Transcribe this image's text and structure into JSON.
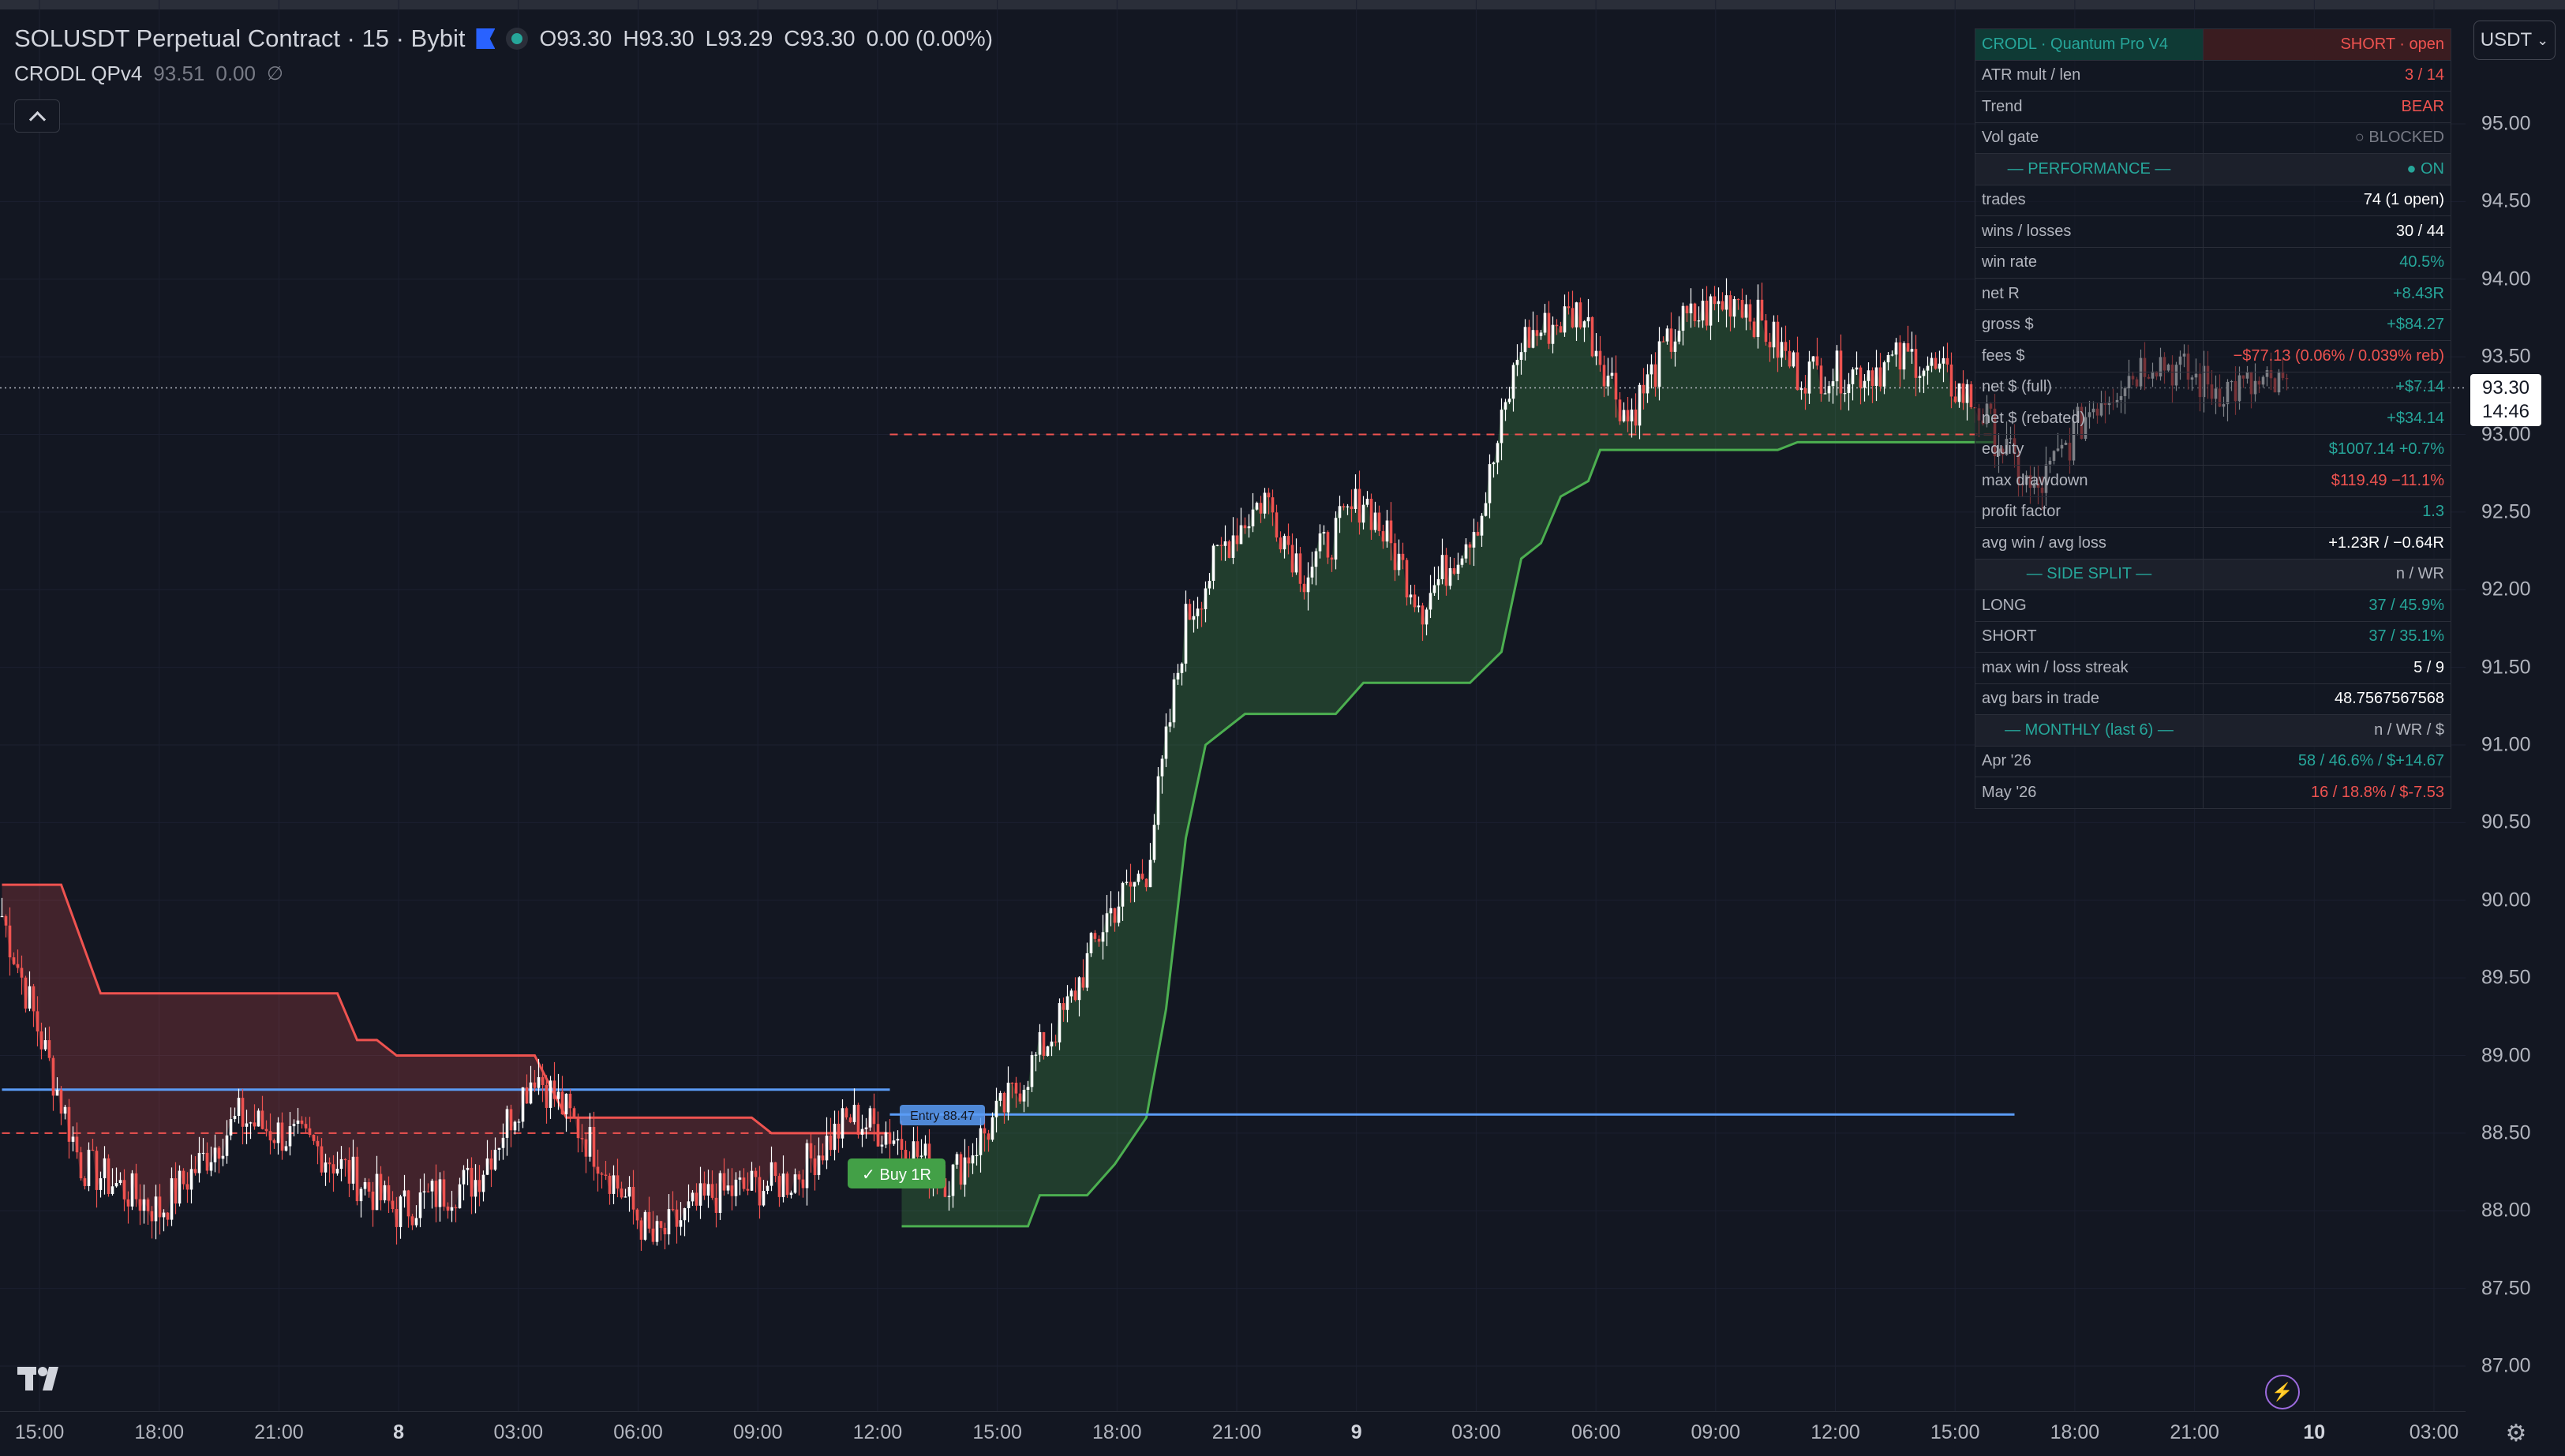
{
  "header": {
    "symbol_title": "SOLUSDT Perpetual Contract · 15 · Bybit",
    "ohlc": [
      {
        "key": "O",
        "value": "93.30"
      },
      {
        "key": "H",
        "value": "93.30"
      },
      {
        "key": "L",
        "value": "93.29"
      },
      {
        "key": "C",
        "value": "93.30"
      }
    ],
    "change": "0.00 (0.00%)"
  },
  "indicator": {
    "name": "CRODL QPv4",
    "value1": "93.51",
    "value2": "0.00",
    "eye_icon": "∅"
  },
  "currency": {
    "label": "USDT",
    "chevron": "⌄"
  },
  "price_axis": {
    "ticks": [
      "95.00",
      "94.50",
      "94.00",
      "93.50",
      "93.00",
      "92.50",
      "92.00",
      "91.50",
      "91.00",
      "90.50",
      "90.00",
      "89.50",
      "89.00",
      "88.50",
      "88.00",
      "87.50",
      "87.00"
    ],
    "last_price": "93.30",
    "countdown": "14:46"
  },
  "time_axis": {
    "ticks": [
      {
        "label": "15:00",
        "bold": false
      },
      {
        "label": "18:00",
        "bold": false
      },
      {
        "label": "21:00",
        "bold": false
      },
      {
        "label": "8",
        "bold": true
      },
      {
        "label": "03:00",
        "bold": false
      },
      {
        "label": "06:00",
        "bold": false
      },
      {
        "label": "09:00",
        "bold": false
      },
      {
        "label": "12:00",
        "bold": false
      },
      {
        "label": "15:00",
        "bold": false
      },
      {
        "label": "18:00",
        "bold": false
      },
      {
        "label": "21:00",
        "bold": false
      },
      {
        "label": "9",
        "bold": true
      },
      {
        "label": "03:00",
        "bold": false
      },
      {
        "label": "06:00",
        "bold": false
      },
      {
        "label": "09:00",
        "bold": false
      },
      {
        "label": "12:00",
        "bold": false
      },
      {
        "label": "15:00",
        "bold": false
      },
      {
        "label": "18:00",
        "bold": false
      },
      {
        "label": "21:00",
        "bold": false
      },
      {
        "label": "10",
        "bold": true
      },
      {
        "label": "03:00",
        "bold": false
      }
    ]
  },
  "chart_labels": {
    "buy_label": "✓ Buy 1R",
    "entry_label": "Entry 88.47"
  },
  "stats": {
    "rows": [
      {
        "label": "CRODL · Quantum Pro V4",
        "value": "SHORT · open",
        "kind": "hdr",
        "vclass": ""
      },
      {
        "label": "ATR mult / len",
        "value": "3 / 14",
        "kind": "row",
        "vclass": "c-red"
      },
      {
        "label": "Trend",
        "value": "BEAR",
        "kind": "row",
        "vclass": "c-red"
      },
      {
        "label": "Vol gate",
        "value": "○ BLOCKED",
        "kind": "row",
        "vclass": "c-gray"
      },
      {
        "label": "— PERFORMANCE —",
        "value": "● ON",
        "kind": "section",
        "vclass": "c-teal"
      },
      {
        "label": "trades",
        "value": "74  (1 open)",
        "kind": "row",
        "vclass": "c-white"
      },
      {
        "label": "wins / losses",
        "value": "30 / 44",
        "kind": "row",
        "vclass": "c-white"
      },
      {
        "label": "win rate",
        "value": "40.5%",
        "kind": "row",
        "vclass": "c-green"
      },
      {
        "label": "net R",
        "value": "+8.43R",
        "kind": "row",
        "vclass": "c-green"
      },
      {
        "label": "gross $",
        "value": "+$84.27",
        "kind": "row",
        "vclass": "c-green"
      },
      {
        "label": "fees $",
        "value": "−$77.13  (0.06% / 0.039% reb)",
        "kind": "row",
        "vclass": "c-red"
      },
      {
        "label": "net $ (full)",
        "value": "+$7.14",
        "kind": "row",
        "vclass": "c-green"
      },
      {
        "label": "net $ (rebated)",
        "value": "+$34.14",
        "kind": "row",
        "vclass": "c-green"
      },
      {
        "label": "equity",
        "value": "$1007.14  +0.7%",
        "kind": "row",
        "vclass": "c-green"
      },
      {
        "label": "max drawdown",
        "value": "$119.49  −11.1%",
        "kind": "row",
        "vclass": "c-red"
      },
      {
        "label": "profit factor",
        "value": "1.3",
        "kind": "row",
        "vclass": "c-green"
      },
      {
        "label": "avg win / avg loss",
        "value": "+1.23R / −0.64R",
        "kind": "row",
        "vclass": "c-white"
      },
      {
        "label": "— SIDE SPLIT —",
        "value": "n / WR",
        "kind": "section",
        "vclass": ""
      },
      {
        "label": "LONG",
        "value": "37 / 45.9%",
        "kind": "row",
        "vclass": "c-green"
      },
      {
        "label": "SHORT",
        "value": "37 / 35.1%",
        "kind": "row",
        "vclass": "c-green"
      },
      {
        "label": "max win / loss streak",
        "value": "5 / 9",
        "kind": "row",
        "vclass": "c-white"
      },
      {
        "label": "avg bars in trade",
        "value": "48.7567567568",
        "kind": "row",
        "vclass": "c-white"
      },
      {
        "label": "— MONTHLY  (last 6) —",
        "value": "n / WR / $",
        "kind": "section",
        "vclass": ""
      },
      {
        "label": "Apr '26",
        "value": "58 / 46.6% / $+14.67",
        "kind": "row",
        "vclass": "c-green"
      },
      {
        "label": "May '26",
        "value": "16 / 18.8% / $-7.53",
        "kind": "row",
        "vclass": "c-red"
      }
    ]
  },
  "colors": {
    "background": "#131722",
    "up": "#ffffff",
    "down": "#ef5350",
    "trail_long": "#4caf50",
    "trail_short": "#ef5350",
    "level_line": "#5b9cf6"
  },
  "chart_data": {
    "type": "candlestick",
    "symbol": "SOLUSDT",
    "interval": "15",
    "y_range": [
      86.8,
      95.6
    ],
    "anchors": [
      {
        "i": 0,
        "p": 89.9
      },
      {
        "i": 20,
        "p": 88.3
      },
      {
        "i": 40,
        "p": 88.0
      },
      {
        "i": 60,
        "p": 88.6
      },
      {
        "i": 80,
        "p": 88.4
      },
      {
        "i": 100,
        "p": 88.0
      },
      {
        "i": 120,
        "p": 88.2
      },
      {
        "i": 135,
        "p": 88.9
      },
      {
        "i": 150,
        "p": 88.4
      },
      {
        "i": 165,
        "p": 87.8
      },
      {
        "i": 180,
        "p": 88.1
      },
      {
        "i": 200,
        "p": 88.2
      },
      {
        "i": 215,
        "p": 88.6
      },
      {
        "i": 225,
        "p": 88.5
      },
      {
        "i": 240,
        "p": 88.2
      },
      {
        "i": 255,
        "p": 88.7
      },
      {
        "i": 270,
        "p": 89.3
      },
      {
        "i": 280,
        "p": 89.9
      },
      {
        "i": 290,
        "p": 90.2
      },
      {
        "i": 300,
        "p": 91.8
      },
      {
        "i": 310,
        "p": 92.3
      },
      {
        "i": 320,
        "p": 92.6
      },
      {
        "i": 330,
        "p": 92.1
      },
      {
        "i": 345,
        "p": 92.6
      },
      {
        "i": 360,
        "p": 91.9
      },
      {
        "i": 375,
        "p": 92.5
      },
      {
        "i": 385,
        "p": 93.6
      },
      {
        "i": 400,
        "p": 93.8
      },
      {
        "i": 412,
        "p": 93.1
      },
      {
        "i": 425,
        "p": 93.7
      },
      {
        "i": 440,
        "p": 93.9
      },
      {
        "i": 455,
        "p": 93.4
      },
      {
        "i": 470,
        "p": 93.4
      },
      {
        "i": 485,
        "p": 93.5
      },
      {
        "i": 500,
        "p": 93.2
      },
      {
        "i": 515,
        "p": 92.6
      },
      {
        "i": 530,
        "p": 93.2
      },
      {
        "i": 545,
        "p": 93.5
      },
      {
        "i": 560,
        "p": 93.3
      },
      {
        "i": 575,
        "p": 93.3
      }
    ],
    "overlays": {
      "short_trail": [
        {
          "i": 0,
          "p": 90.1
        },
        {
          "i": 15,
          "p": 90.1
        },
        {
          "i": 25,
          "p": 89.4
        },
        {
          "i": 85,
          "p": 89.4
        },
        {
          "i": 90,
          "p": 89.1
        },
        {
          "i": 95,
          "p": 89.1
        },
        {
          "i": 100,
          "p": 89.0
        },
        {
          "i": 135,
          "p": 89.0
        },
        {
          "i": 143,
          "p": 88.6
        },
        {
          "i": 190,
          "p": 88.6
        },
        {
          "i": 195,
          "p": 88.5
        },
        {
          "i": 224,
          "p": 88.5
        }
      ],
      "long_trail": [
        {
          "i": 228,
          "p": 87.9
        },
        {
          "i": 260,
          "p": 87.9
        },
        {
          "i": 263,
          "p": 88.1
        },
        {
          "i": 275,
          "p": 88.1
        },
        {
          "i": 282,
          "p": 88.3
        },
        {
          "i": 290,
          "p": 88.6
        },
        {
          "i": 295,
          "p": 89.3
        },
        {
          "i": 300,
          "p": 90.4
        },
        {
          "i": 305,
          "p": 91.0
        },
        {
          "i": 315,
          "p": 91.2
        },
        {
          "i": 338,
          "p": 91.2
        },
        {
          "i": 345,
          "p": 91.4
        },
        {
          "i": 372,
          "p": 91.4
        },
        {
          "i": 380,
          "p": 91.6
        },
        {
          "i": 385,
          "p": 92.2
        },
        {
          "i": 390,
          "p": 92.3
        },
        {
          "i": 395,
          "p": 92.6
        },
        {
          "i": 402,
          "p": 92.7
        },
        {
          "i": 405,
          "p": 92.9
        },
        {
          "i": 450,
          "p": 92.9
        },
        {
          "i": 455,
          "p": 92.95
        },
        {
          "i": 505,
          "p": 92.95
        }
      ],
      "level_lines": [
        {
          "from": 0,
          "to": 225,
          "p": 88.78
        },
        {
          "from": 225,
          "to": 510,
          "p": 88.62
        }
      ],
      "dashed_lines": [
        {
          "from": 0,
          "to": 225,
          "p": 88.5
        },
        {
          "from": 225,
          "to": 505,
          "p": 93.0
        }
      ],
      "last_price_line": 93.3
    }
  }
}
